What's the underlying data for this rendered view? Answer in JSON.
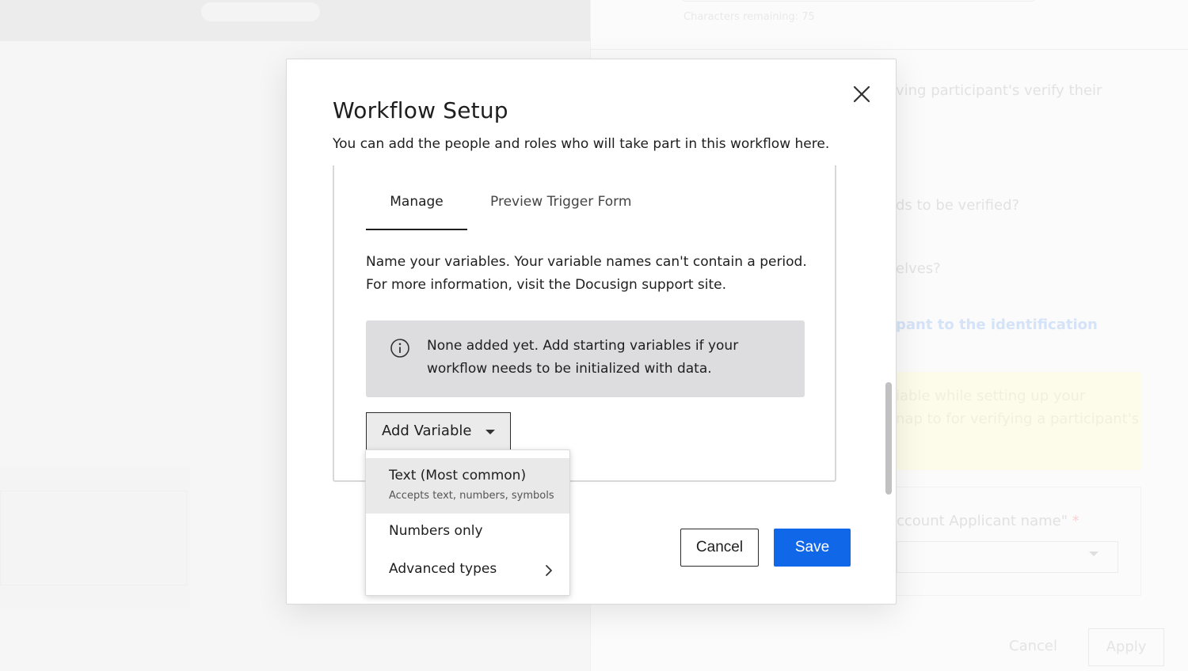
{
  "modal": {
    "title": "Workflow Setup",
    "subtitle": "You can add the people and roles who will take part in this workflow here.",
    "tabs": [
      {
        "label": "Manage",
        "active": true
      },
      {
        "label": "Preview Trigger Form",
        "active": false
      }
    ],
    "description": "Name your variables. Your variable names can't contain a period. For more information, visit the Docusign support site.",
    "info_text": "None added yet. Add starting variables if your workflow needs to be initialized with data.",
    "add_variable_label": "Add Variable",
    "cancel_label": "Cancel",
    "save_label": "Save"
  },
  "dropdown": {
    "items": [
      {
        "label": "Text (Most common)",
        "sublabel": "Accepts text, numbers, symbols",
        "highlighted": true
      },
      {
        "label": "Numbers only"
      },
      {
        "label": "Advanced types",
        "has_submenu": true
      }
    ]
  },
  "background": {
    "characters_remaining": "Characters remaining: 75",
    "question_1": "ving participant's verify their",
    "question_2": "ds to be verified?",
    "question_3": "elves?",
    "link_text": "pant to the identification",
    "warning_line_1": "iable while setting up your",
    "warning_line_2": "nap to for verifying a participant's",
    "field_label": "ccount Applicant name\"",
    "field_required": "*",
    "cancel_label": "Cancel",
    "apply_label": "Apply"
  },
  "colors": {
    "primary_button": "#1068e9",
    "info_background": "#dddde0",
    "text": "#1e1e1e"
  },
  "icons": [
    "close-icon",
    "info-icon",
    "caret-down-icon",
    "chevron-right-icon"
  ]
}
